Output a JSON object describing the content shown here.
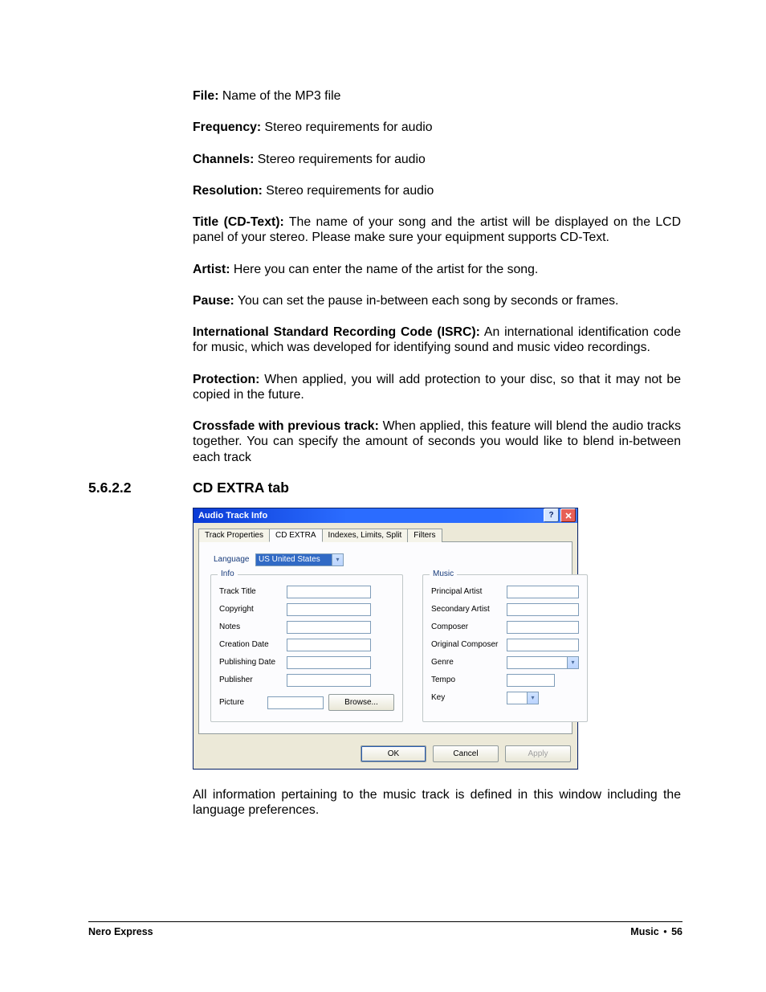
{
  "defs": [
    {
      "label": "File:",
      "text": "Name of the MP3 file",
      "justify": false
    },
    {
      "label": "Frequency:",
      "text": "Stereo requirements for audio",
      "justify": false
    },
    {
      "label": "Channels:",
      "text": "Stereo requirements for audio",
      "justify": false
    },
    {
      "label": "Resolution:",
      "text": "Stereo requirements for audio",
      "justify": false
    },
    {
      "label": "Title (CD-Text):",
      "text": "The name of your song and the artist will be displayed on the LCD panel of your stereo. Please make sure your equipment supports CD-Text.",
      "justify": true
    },
    {
      "label": "Artist:",
      "text": "Here you can enter the name of the artist for the song.",
      "justify": false
    },
    {
      "label": "Pause:",
      "text": "You can set the pause in-between each song by seconds or frames.",
      "justify": false
    },
    {
      "label": "International Standard Recording Code (ISRC):",
      "text": "An international identification code for music, which was developed for identifying sound and music video recordings.",
      "justify": true
    },
    {
      "label": "Protection:",
      "text": "When applied, you will add protection to your disc, so that it may not be copied in the future.",
      "justify": true
    },
    {
      "label": "Crossfade with previous track:",
      "text": "When applied, this feature will blend the audio tracks together. You can specify the amount of seconds you would like to blend in-between each track",
      "justify": true
    }
  ],
  "section": {
    "num": "5.6.2.2",
    "title": "CD EXTRA tab"
  },
  "dialog": {
    "title": "Audio Track Info",
    "tabs": [
      "Track Properties",
      "CD EXTRA",
      "Indexes, Limits, Split",
      "Filters"
    ],
    "active_tab": 1,
    "language_label": "Language",
    "language_value": "US United States",
    "groups": {
      "info": {
        "title": "Info",
        "fields": {
          "track_title": "Track Title",
          "copyright": "Copyright",
          "notes": "Notes",
          "creation_date": "Creation Date",
          "publishing_date": "Publishing Date",
          "publisher": "Publisher",
          "picture": "Picture",
          "browse": "Browse..."
        }
      },
      "music": {
        "title": "Music",
        "fields": {
          "principal_artist": "Principal Artist",
          "secondary_artist": "Secondary Artist",
          "composer": "Composer",
          "original_composer": "Original Composer",
          "genre": "Genre",
          "tempo": "Tempo",
          "key": "Key"
        }
      }
    },
    "buttons": {
      "ok": "OK",
      "cancel": "Cancel",
      "apply": "Apply"
    }
  },
  "after_figure": "All information pertaining to the music track is defined in this window including the language preferences.",
  "footer": {
    "left": "Nero Express",
    "right_label": "Music",
    "bullet": "•",
    "page": "56"
  }
}
